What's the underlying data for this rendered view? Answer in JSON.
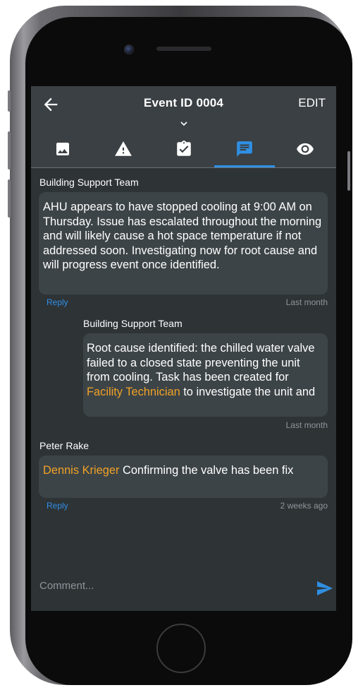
{
  "header": {
    "title": "Event ID 0004",
    "edit_label": "EDIT"
  },
  "tabs": [
    {
      "icon": "image-icon",
      "active": false
    },
    {
      "icon": "warning-icon",
      "active": false
    },
    {
      "icon": "clipboard-check-icon",
      "active": false
    },
    {
      "icon": "comment-icon",
      "active": true
    },
    {
      "icon": "eye-icon",
      "active": false
    }
  ],
  "comments": [
    {
      "author": "Building Support Team",
      "text": "AHU appears to have stopped cooling at 9:00 AM on Thursday. Issue has escalated throughout the morning and will likely cause a hot space temperature if not addressed soon. Investigating now for root cause and will progress event once identified.",
      "reply_label": "Reply",
      "timestamp": "Last month"
    },
    {
      "author": "Building Support Team",
      "text_before": "Root cause identified: the chilled water valve failed to a closed state preventing the unit from cooling. Task has been created for ",
      "mention": "Facility Technician",
      "text_after": " to investigate the unit and",
      "timestamp": "Last month"
    },
    {
      "author": "Peter Rake",
      "mention": "Dennis Krieger",
      "text_after": " Confirming the valve has been fix",
      "reply_label": "Reply",
      "timestamp": "2 weeks ago"
    }
  ],
  "composer": {
    "placeholder": "Comment..."
  },
  "colors": {
    "accent": "#2f8fe3",
    "mention": "#f0a225",
    "screen_bg": "#2e3336",
    "header_bg": "#3a4044",
    "bubble_bg": "#3d4448"
  }
}
